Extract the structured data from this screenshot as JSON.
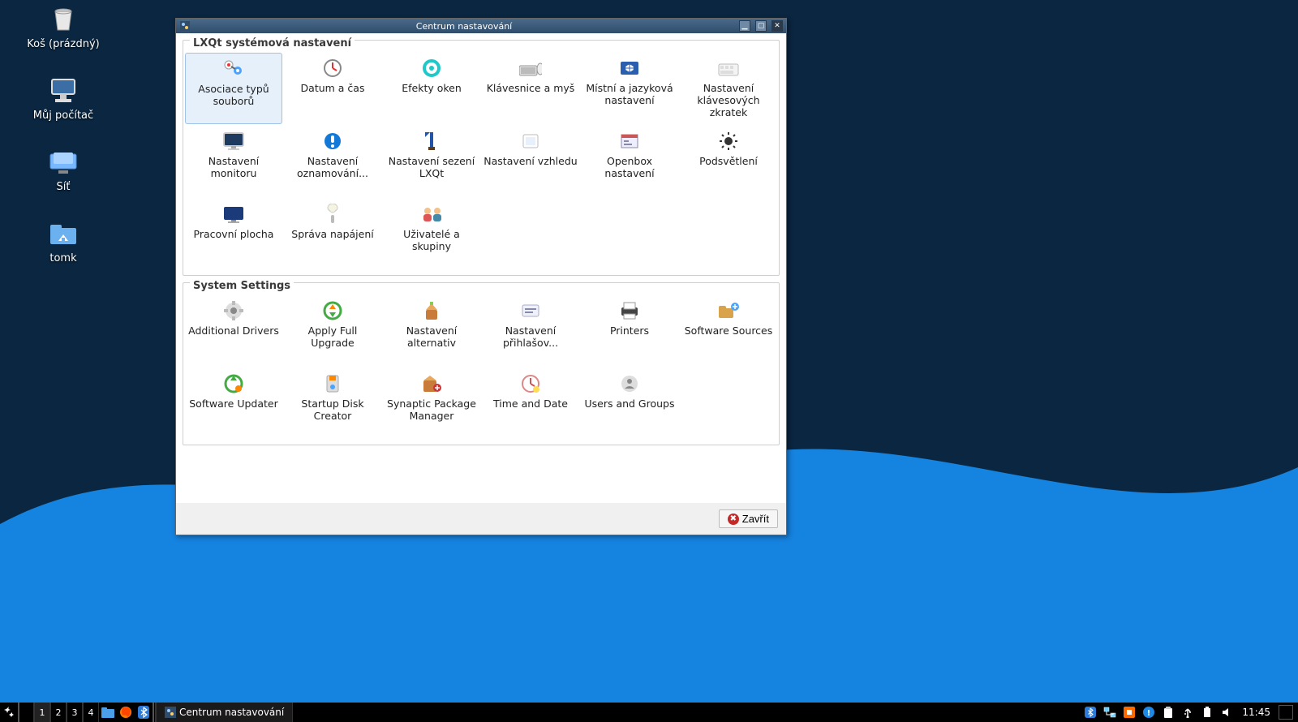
{
  "desktop": {
    "icons": [
      {
        "name": "trash",
        "label": "Koš (prázdný)"
      },
      {
        "name": "computer",
        "label": "Můj počítač"
      },
      {
        "name": "network",
        "label": "Síť"
      },
      {
        "name": "home",
        "label": "tomk"
      }
    ]
  },
  "window": {
    "title": "Centrum nastavování",
    "close_label": "Zavřít",
    "group1_label": "LXQt systémová nastavení",
    "group2_label": "System Settings",
    "g1": [
      {
        "id": "file-assoc",
        "label": "Asociace typů souborů",
        "selected": true
      },
      {
        "id": "date-time",
        "label": "Datum a čas"
      },
      {
        "id": "win-effects",
        "label": "Efekty oken"
      },
      {
        "id": "kb-mouse",
        "label": "Klávesnice a myš"
      },
      {
        "id": "locale",
        "label": "Místní a jazyková nastavení"
      },
      {
        "id": "shortcuts",
        "label": "Nastavení klávesových zkratek"
      },
      {
        "id": "monitor",
        "label": "Nastavení monitoru"
      },
      {
        "id": "notifications",
        "label": "Nastavení oznamování..."
      },
      {
        "id": "session",
        "label": "Nastavení sezení LXQt"
      },
      {
        "id": "appearance",
        "label": "Nastavení vzhledu"
      },
      {
        "id": "openbox",
        "label": "Openbox nastavení"
      },
      {
        "id": "backlight",
        "label": "Podsvětlení"
      },
      {
        "id": "desktop",
        "label": "Pracovní plocha"
      },
      {
        "id": "power",
        "label": "Správa napájení"
      },
      {
        "id": "users-groups",
        "label": "Uživatelé a skupiny"
      }
    ],
    "g2": [
      {
        "id": "additional-drivers",
        "label": "Additional Drivers"
      },
      {
        "id": "full-upgrade",
        "label": "Apply Full Upgrade"
      },
      {
        "id": "alternatives",
        "label": "Nastavení alternativ"
      },
      {
        "id": "login-settings",
        "label": "Nastavení přihlašov..."
      },
      {
        "id": "printers",
        "label": "Printers"
      },
      {
        "id": "software-sources",
        "label": "Software Sources"
      },
      {
        "id": "software-updater",
        "label": "Software Updater"
      },
      {
        "id": "startup-disk",
        "label": "Startup Disk Creator"
      },
      {
        "id": "synaptic",
        "label": "Synaptic Package Manager"
      },
      {
        "id": "time-date",
        "label": "Time and Date"
      },
      {
        "id": "users-groups-sys",
        "label": "Users and Groups"
      }
    ]
  },
  "taskbar": {
    "workspaces": [
      "1",
      "2",
      "3",
      "4"
    ],
    "task_label": "Centrum nastavování",
    "clock": "11:45"
  }
}
